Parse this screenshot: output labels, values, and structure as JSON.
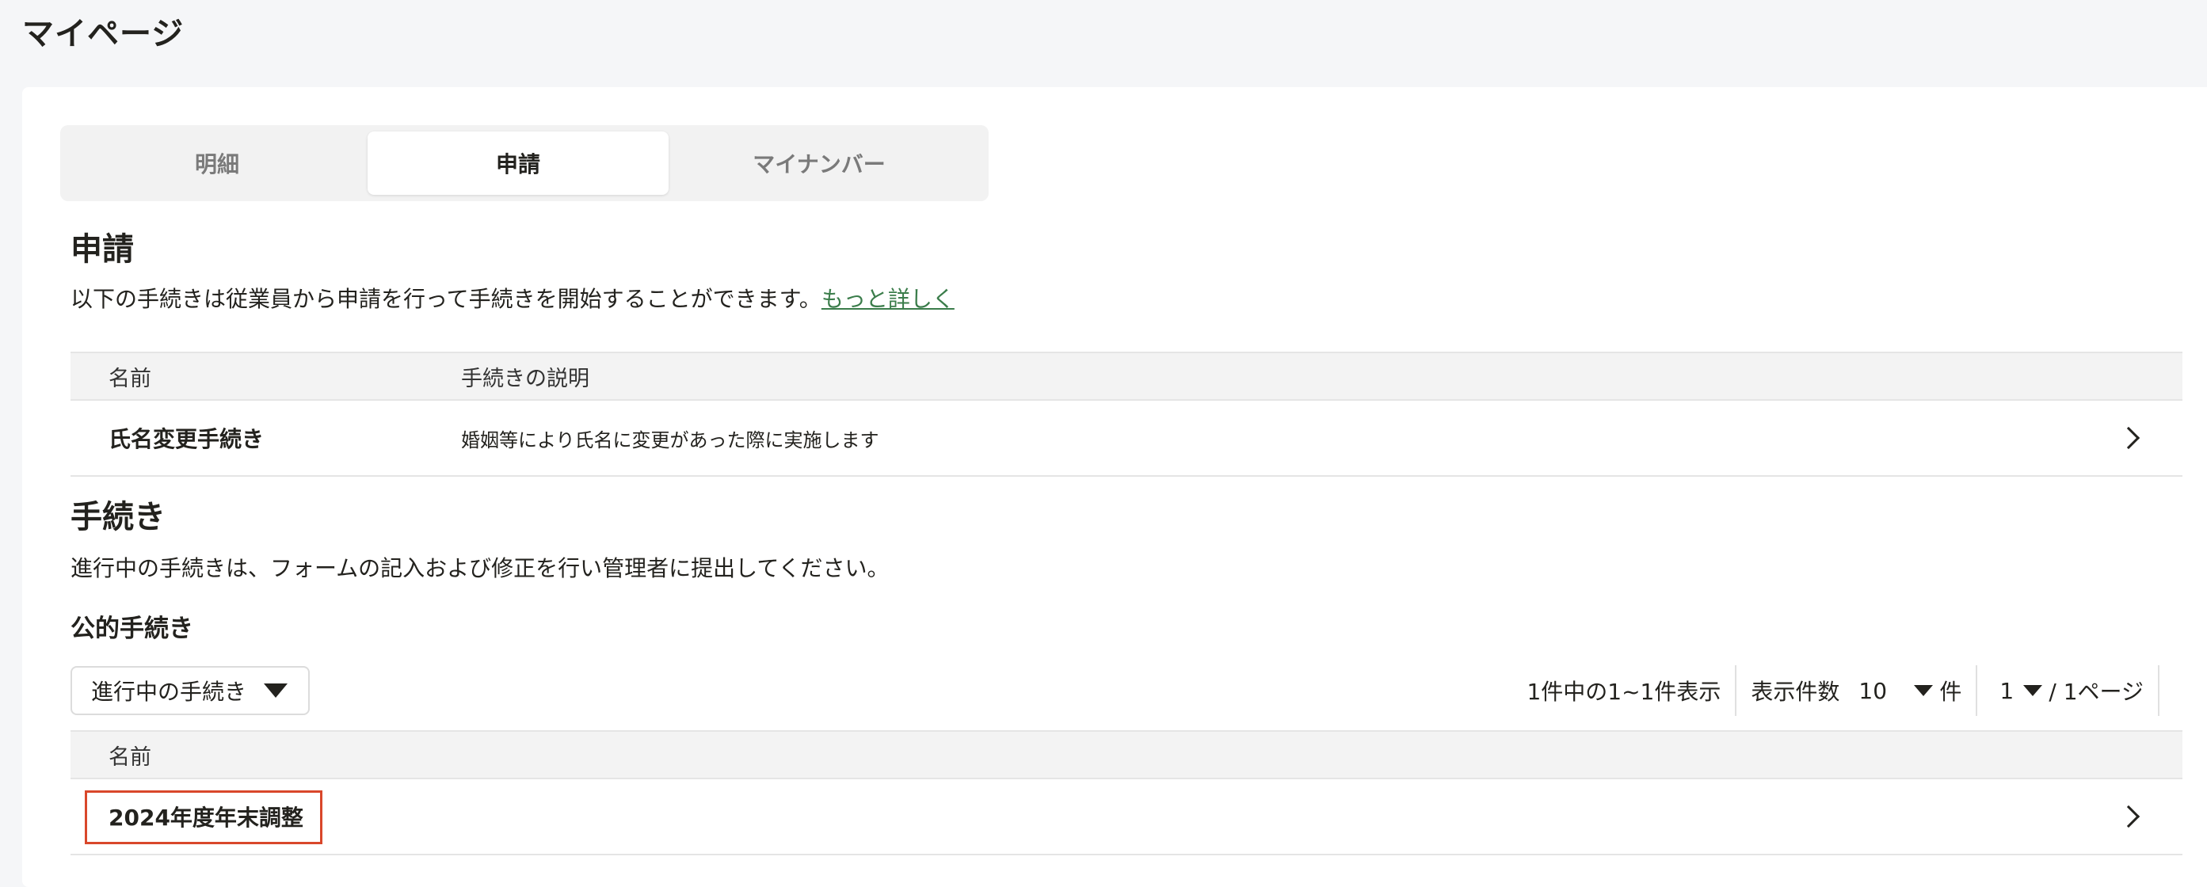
{
  "page": {
    "title": "マイページ"
  },
  "tabs": [
    {
      "label": "明細",
      "active": false
    },
    {
      "label": "申請",
      "active": true
    },
    {
      "label": "マイナンバー",
      "active": false
    }
  ],
  "application": {
    "heading": "申請",
    "description": "以下の手続きは従業員から申請を行って手続きを開始することができます。",
    "more_link": "もっと詳しく",
    "table": {
      "headers": [
        "名前",
        "手続きの説明"
      ],
      "rows": [
        {
          "name": "氏名変更手続き",
          "description": "婚姻等により氏名に変更があった際に実施します"
        }
      ]
    }
  },
  "procedures": {
    "heading": "手続き",
    "description": "進行中の手続きは、フォームの記入および修正を行い管理者に提出してください。",
    "subheading": "公的手続き",
    "filter_label": "進行中の手続き",
    "pager": {
      "summary": "1件中の1~1件表示",
      "per_page_label": "表示件数",
      "per_page_value": "10",
      "per_page_unit": "件",
      "page_value": "1",
      "page_total": "/ 1ページ"
    },
    "table": {
      "headers": [
        "名前"
      ],
      "rows": [
        {
          "name": "2024年度年末調整"
        }
      ]
    }
  },
  "colors": {
    "link": "#3b7d4b",
    "highlight": "#d9472b",
    "background": "#f5f6f8"
  }
}
